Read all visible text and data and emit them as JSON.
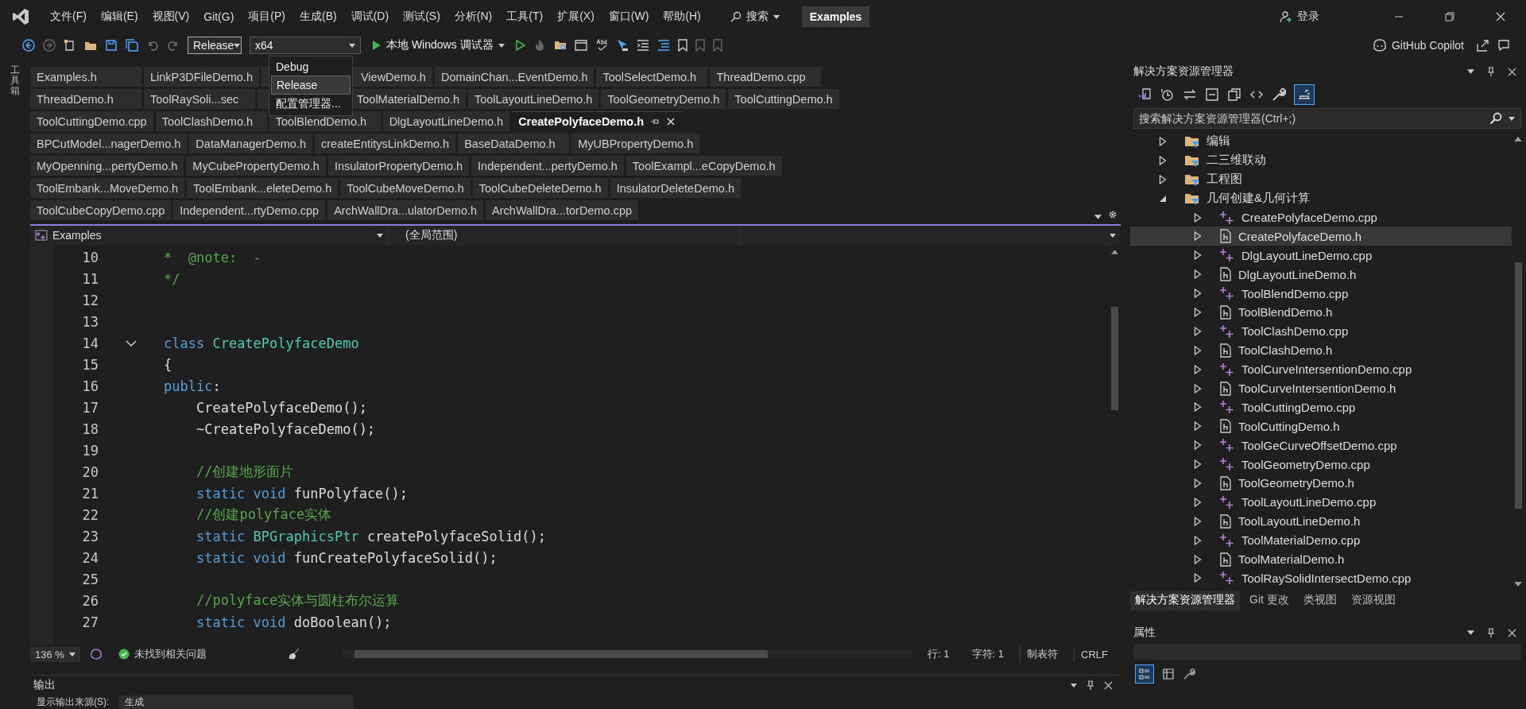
{
  "menu": [
    "文件(F)",
    "编辑(E)",
    "视图(V)",
    "Git(G)",
    "项目(P)",
    "生成(B)",
    "调试(D)",
    "测试(S)",
    "分析(N)",
    "工具(T)",
    "扩展(X)",
    "窗口(W)",
    "帮助(H)"
  ],
  "search": {
    "label": "搜索"
  },
  "solution_name": "Examples",
  "sign_in": "登录",
  "toolbar": {
    "configuration": "Release",
    "platform": "x64",
    "debugger": "本地 Windows 调试器",
    "copilot": "GitHub Copilot"
  },
  "config_menu": [
    {
      "label": "Debug",
      "selected": false
    },
    {
      "label": "Release",
      "selected": true
    },
    {
      "label": "配置管理器...",
      "selected": false
    }
  ],
  "toolbox": "工具箱",
  "tab_rows": [
    [
      {
        "label": "Examples.h",
        "selected": false
      },
      {
        "label": "LinkP3DFileDemo.h",
        "selected": false
      },
      {
        "label": "ViewDemo.h",
        "selected": false
      },
      {
        "label": "DomainChan...EventDemo.h",
        "selected": false
      },
      {
        "label": "ToolSelectDemo.h",
        "selected": false
      },
      {
        "label": "ThreadDemo.cpp",
        "selected": false
      }
    ],
    [
      {
        "label": "ThreadDemo.h",
        "selected": false
      },
      {
        "label": "ToolRaySoli...sec",
        "selected": false
      },
      {
        "label": "ToolMaterialDemo.h",
        "selected": false
      },
      {
        "label": "ToolLayoutLineDemo.h",
        "selected": false
      },
      {
        "label": "ToolGeometryDemo.h",
        "selected": false
      },
      {
        "label": "ToolCuttingDemo.h",
        "selected": false
      }
    ],
    [
      {
        "label": "ToolCuttingDemo.cpp",
        "selected": false
      },
      {
        "label": "ToolClashDemo.h",
        "selected": false
      },
      {
        "label": "ToolBlendDemo.h",
        "selected": false
      },
      {
        "label": "DlgLayoutLineDemo.h",
        "selected": false
      },
      {
        "label": "CreatePolyfaceDemo.h",
        "selected": true
      }
    ],
    [
      {
        "label": "BPCutModel...nagerDemo.h",
        "selected": false
      },
      {
        "label": "DataManagerDemo.h",
        "selected": false
      },
      {
        "label": "createEntitysLinkDemo.h",
        "selected": false
      },
      {
        "label": "BaseDataDemo.h",
        "selected": false
      },
      {
        "label": "MyUBPropertyDemo.h",
        "selected": false
      }
    ],
    [
      {
        "label": "MyOpenning...pertyDemo.h",
        "selected": false
      },
      {
        "label": "MyCubePropertyDemo.h",
        "selected": false
      },
      {
        "label": "InsulatorPropertyDemo.h",
        "selected": false
      },
      {
        "label": "Independent...pertyDemo.h",
        "selected": false
      },
      {
        "label": "ToolExampl...eCopyDemo.h",
        "selected": false
      }
    ],
    [
      {
        "label": "ToolEmbank...MoveDemo.h",
        "selected": false
      },
      {
        "label": "ToolEmbank...eleteDemo.h",
        "selected": false
      },
      {
        "label": "ToolCubeMoveDemo.h",
        "selected": false
      },
      {
        "label": "ToolCubeDeleteDemo.h",
        "selected": false
      },
      {
        "label": "InsulatorDeleteDemo.h",
        "selected": false
      }
    ],
    [
      {
        "label": "ToolCubeCopyDemo.cpp",
        "selected": false
      },
      {
        "label": "Independent...rtyDemo.cpp",
        "selected": false
      },
      {
        "label": "ArchWallDra...ulatorDemo.h",
        "selected": false
      },
      {
        "label": "ArchWallDra...torDemo.cpp",
        "selected": false
      }
    ]
  ],
  "navigation": {
    "project": "Examples",
    "scope": "(全局范围)"
  },
  "code_lines": [
    {
      "number": "10",
      "tokens": [
        {
          "kind": "comment",
          "text": "*  @note:  -"
        }
      ]
    },
    {
      "number": "11",
      "tokens": [
        {
          "kind": "comment",
          "text": "*/"
        }
      ]
    },
    {
      "number": "12"
    },
    {
      "number": "13"
    },
    {
      "number": "14",
      "expanded": true,
      "tokens": [
        {
          "kind": "keyword",
          "text": "class"
        },
        {
          "kind": "type",
          "text": " CreatePolyfaceDemo"
        }
      ]
    },
    {
      "number": "15",
      "tokens": [
        {
          "kind": "plain",
          "text": "{"
        }
      ]
    },
    {
      "number": "16",
      "tokens": [
        {
          "kind": "keyword",
          "text": "public"
        },
        {
          "kind": "plain",
          "text": ":"
        }
      ]
    },
    {
      "number": "17",
      "tokens": [
        {
          "kind": "plain",
          "text": "    CreatePolyfaceDemo();"
        }
      ]
    },
    {
      "number": "18",
      "tokens": [
        {
          "kind": "plain",
          "text": "    ~CreatePolyfaceDemo();"
        }
      ]
    },
    {
      "number": "19"
    },
    {
      "number": "20",
      "tokens": [
        {
          "kind": "comment",
          "text": "    //创建地形面片"
        }
      ]
    },
    {
      "number": "21",
      "tokens": [
        {
          "kind": "keyword",
          "text": "    static void"
        },
        {
          "kind": "plain",
          "text": " funPolyface();"
        }
      ]
    },
    {
      "number": "22",
      "tokens": [
        {
          "kind": "comment",
          "text": "    //创建polyface实体"
        }
      ]
    },
    {
      "number": "23",
      "tokens": [
        {
          "kind": "keyword",
          "text": "    static"
        },
        {
          "kind": "type",
          "text": " BPGraphicsPtr"
        },
        {
          "kind": "plain",
          "text": " createPolyfaceSolid();"
        }
      ]
    },
    {
      "number": "24",
      "tokens": [
        {
          "kind": "keyword",
          "text": "    static void"
        },
        {
          "kind": "plain",
          "text": " funCreatePolyfaceSolid();"
        }
      ]
    },
    {
      "number": "25"
    },
    {
      "number": "26",
      "tokens": [
        {
          "kind": "comment",
          "text": "    //polyface实体与圆柱布尔运算"
        }
      ]
    },
    {
      "number": "27",
      "tokens": [
        {
          "kind": "keyword",
          "text": "    static void"
        },
        {
          "kind": "plain",
          "text": " doBoolean();"
        }
      ]
    }
  ],
  "editor_status": {
    "zoom": "136 %",
    "issues": "未找到相关问题",
    "line": "行: 1",
    "char": "字符: 1",
    "indent": "制表符",
    "line_ending": "CRLF"
  },
  "output": {
    "title": "输出",
    "source_label": "显示输出来源(S):",
    "source": "生成"
  },
  "solution_explorer": {
    "title": "解决方案资源管理器",
    "search_placeholder": "搜索解决方案资源管理器(Ctrl+;)",
    "tree": [
      {
        "label": "编辑",
        "kind": "folder",
        "expanded": false,
        "selected": false
      },
      {
        "label": "二三维联动",
        "kind": "folder",
        "expanded": false,
        "selected": false
      },
      {
        "label": "工程图",
        "kind": "folder",
        "expanded": false,
        "selected": false
      },
      {
        "label": "几何创建&几何计算",
        "kind": "folder",
        "expanded": true,
        "selected": false,
        "children": [
          {
            "label": "CreatePolyfaceDemo.cpp",
            "kind": "cpp",
            "expanded": false,
            "selected": false
          },
          {
            "label": "CreatePolyfaceDemo.h",
            "kind": "header",
            "expanded": false,
            "selected": true
          },
          {
            "label": "DlgLayoutLineDemo.cpp",
            "kind": "cpp",
            "expanded": false,
            "selected": false
          },
          {
            "label": "DlgLayoutLineDemo.h",
            "kind": "header",
            "expanded": false,
            "selected": false
          },
          {
            "label": "ToolBlendDemo.cpp",
            "kind": "cpp",
            "expanded": false,
            "selected": false
          },
          {
            "label": "ToolBlendDemo.h",
            "kind": "header",
            "expanded": false,
            "selected": false
          },
          {
            "label": "ToolClashDemo.cpp",
            "kind": "cpp",
            "expanded": false,
            "selected": false
          },
          {
            "label": "ToolClashDemo.h",
            "kind": "header",
            "expanded": false,
            "selected": false
          },
          {
            "label": "ToolCurveIntersentionDemo.cpp",
            "kind": "cpp",
            "expanded": false,
            "selected": false
          },
          {
            "label": "ToolCurveIntersentionDemo.h",
            "kind": "header",
            "expanded": false,
            "selected": false
          },
          {
            "label": "ToolCuttingDemo.cpp",
            "kind": "cpp",
            "expanded": false,
            "selected": false
          },
          {
            "label": "ToolCuttingDemo.h",
            "kind": "header",
            "expanded": false,
            "selected": false
          },
          {
            "label": "ToolGeCurveOffsetDemo.cpp",
            "kind": "cpp",
            "expanded": false,
            "selected": false
          },
          {
            "label": "ToolGeometryDemo.cpp",
            "kind": "cpp",
            "expanded": false,
            "selected": false
          },
          {
            "label": "ToolGeometryDemo.h",
            "kind": "header",
            "expanded": false,
            "selected": false
          },
          {
            "label": "ToolLayoutLineDemo.cpp",
            "kind": "cpp",
            "expanded": false,
            "selected": false
          },
          {
            "label": "ToolLayoutLineDemo.h",
            "kind": "header",
            "expanded": false,
            "selected": false
          },
          {
            "label": "ToolMaterialDemo.cpp",
            "kind": "cpp",
            "expanded": false,
            "selected": false
          },
          {
            "label": "ToolMaterialDemo.h",
            "kind": "header",
            "expanded": false,
            "selected": false
          },
          {
            "label": "ToolRaySolidIntersectDemo.cpp",
            "kind": "cpp",
            "expanded": false,
            "selected": false
          }
        ]
      }
    ],
    "bottom_tabs": [
      {
        "label": "解决方案资源管理器",
        "selected": true
      },
      {
        "label": "Git 更改",
        "selected": false
      },
      {
        "label": "类视图",
        "selected": false
      },
      {
        "label": "资源视图",
        "selected": false
      }
    ]
  },
  "properties": {
    "title": "属性"
  }
}
